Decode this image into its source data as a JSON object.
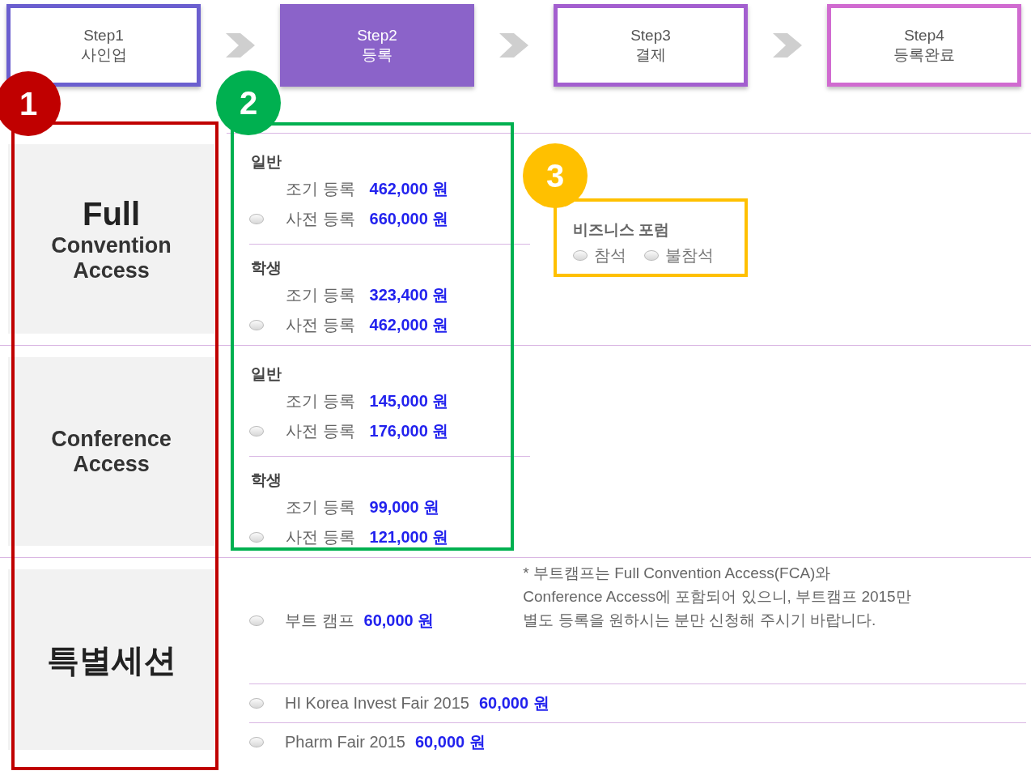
{
  "steps": [
    {
      "label": "Step1",
      "sub": "사인업",
      "selected": false,
      "color": "#6b5fcf"
    },
    {
      "label": "Step2",
      "sub": "등록",
      "selected": true,
      "color": "#8b63c9"
    },
    {
      "label": "Step3",
      "sub": "결제",
      "selected": false,
      "color": "#a35fcf"
    },
    {
      "label": "Step4",
      "sub": "등록완료",
      "selected": false,
      "color": "#d06bd0"
    }
  ],
  "sections": [
    {
      "title": [
        {
          "text": "Full",
          "kind": "major"
        },
        {
          "text": "Convention Access",
          "kind": "minor"
        }
      ],
      "groups": [
        {
          "category": "일반",
          "options": [
            {
              "kind": "plain",
              "label": "조기 등록",
              "price": "462,000 원"
            },
            {
              "kind": "radio",
              "label": "사전 등록",
              "price": "660,000 원",
              "selected": false
            }
          ]
        },
        {
          "category": "학생",
          "options": [
            {
              "kind": "plain",
              "label": "조기 등록",
              "price": "323,400 원"
            },
            {
              "kind": "radio",
              "label": "사전 등록",
              "price": "462,000 원",
              "selected": false
            }
          ]
        }
      ],
      "forum": {
        "title": "비즈니스 포럼",
        "options": [
          {
            "label": "참석",
            "selected": false
          },
          {
            "label": "불참석",
            "selected": false
          }
        ]
      }
    },
    {
      "title": [
        {
          "text": "Conference Access",
          "kind": "minor"
        }
      ],
      "groups": [
        {
          "category": "일반",
          "options": [
            {
              "kind": "plain",
              "label": "조기 등록",
              "price": "145,000 원"
            },
            {
              "kind": "radio",
              "label": "사전 등록",
              "price": "176,000 원",
              "selected": false
            }
          ]
        },
        {
          "category": "학생",
          "options": [
            {
              "kind": "plain",
              "label": "조기 등록",
              "price": "99,000 원"
            },
            {
              "kind": "radio",
              "label": "사전 등록",
              "price": "121,000 원",
              "selected": false
            }
          ]
        }
      ]
    },
    {
      "title": [
        {
          "text": "특별세션",
          "kind": "major"
        }
      ],
      "items": [
        {
          "label": "부트 캠프",
          "price": "60,000 원",
          "selected": false,
          "note": "* 부트캠프는 Full Convention Access(FCA)와\nConference Access에 포함되어 있으니, 부트캠프 2015만\n별도 등록을 원하시는 분만 신청해 주시기 바랍니다."
        },
        {
          "label": "HI Korea Invest Fair 2015",
          "price": "60,000 원",
          "selected": false
        },
        {
          "label": "Pharm Fair 2015",
          "price": "60,000 원",
          "selected": false
        }
      ]
    }
  ],
  "annotations": [
    {
      "number": "1",
      "color": "#c00000"
    },
    {
      "number": "2",
      "color": "#00b050"
    },
    {
      "number": "3",
      "color": "#ffc000"
    }
  ]
}
